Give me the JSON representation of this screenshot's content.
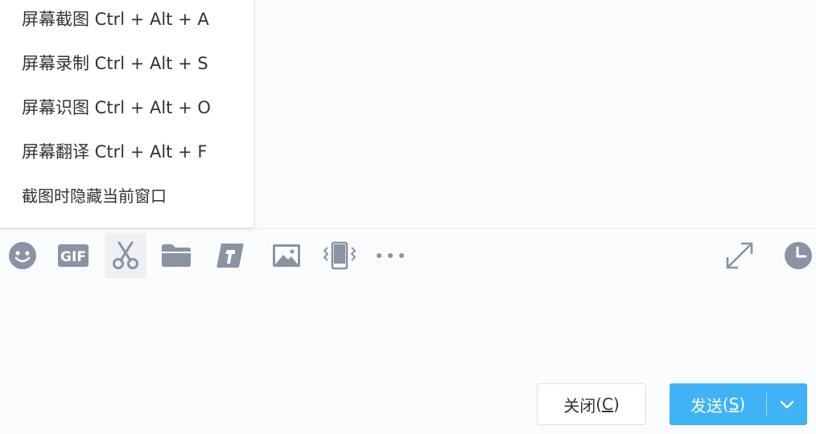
{
  "screenshot_menu": {
    "items": [
      {
        "label": "屏幕截图 Ctrl + Alt + A"
      },
      {
        "label": "屏幕录制 Ctrl + Alt + S"
      },
      {
        "label": "屏幕识图 Ctrl + Alt + O"
      },
      {
        "label": "屏幕翻译 Ctrl + Alt + F"
      },
      {
        "label": "截图时隐藏当前窗口"
      }
    ]
  },
  "toolbar": {
    "icons": [
      "emoji-icon",
      "gif-icon",
      "scissors-icon",
      "folder-icon",
      "file-transfer-icon",
      "image-icon",
      "phone-shake-icon",
      "more-icon",
      "expand-icon",
      "history-clock-icon"
    ],
    "gif_text": "GIF"
  },
  "footer": {
    "close_label": "关闭",
    "close_key": "C",
    "send_label": "发送",
    "send_key": "S"
  },
  "colors": {
    "accent": "#3fb3f6",
    "icon": "#8a93a3"
  }
}
